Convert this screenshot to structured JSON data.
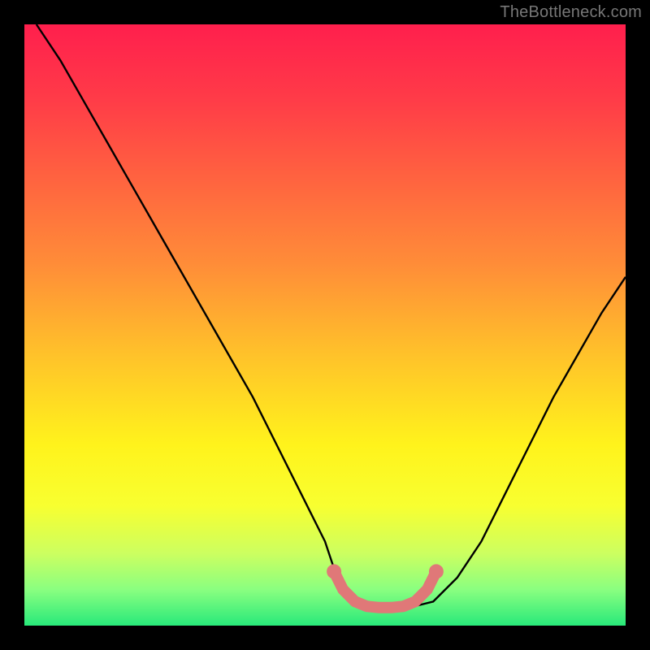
{
  "watermark": "TheBottleneck.com",
  "gradient_stops": [
    {
      "offset": 0.0,
      "color": "#ff1f4d"
    },
    {
      "offset": 0.12,
      "color": "#ff3a48"
    },
    {
      "offset": 0.25,
      "color": "#ff6140"
    },
    {
      "offset": 0.4,
      "color": "#ff8d38"
    },
    {
      "offset": 0.55,
      "color": "#ffc22a"
    },
    {
      "offset": 0.7,
      "color": "#fff31c"
    },
    {
      "offset": 0.8,
      "color": "#f8ff30"
    },
    {
      "offset": 0.88,
      "color": "#ccff60"
    },
    {
      "offset": 0.94,
      "color": "#8aff80"
    },
    {
      "offset": 1.0,
      "color": "#28e97a"
    }
  ],
  "curve_color": "#000000",
  "curve_width": 2.4,
  "marker_color": "#e07878",
  "chart_data": {
    "type": "line",
    "title": "",
    "xlabel": "",
    "ylabel": "",
    "xlim": [
      0,
      100
    ],
    "ylim": [
      0,
      100
    ],
    "series": [
      {
        "name": "valley-curve",
        "x": [
          2,
          6,
          10,
          14,
          18,
          22,
          26,
          30,
          34,
          38,
          42,
          46,
          50,
          52,
          56,
          60,
          64,
          68,
          72,
          76,
          80,
          84,
          88,
          92,
          96,
          100
        ],
        "y": [
          100,
          94,
          87,
          80,
          73,
          66,
          59,
          52,
          45,
          38,
          30,
          22,
          14,
          8,
          4,
          3,
          3,
          4,
          8,
          14,
          22,
          30,
          38,
          45,
          52,
          58
        ]
      }
    ],
    "markers": {
      "name": "highlighted-segment",
      "x": [
        51.5,
        53,
        55,
        57,
        59,
        61,
        63,
        65,
        67,
        68.5
      ],
      "y": [
        9,
        6,
        4,
        3.2,
        3,
        3,
        3.2,
        4,
        6,
        9
      ]
    }
  }
}
